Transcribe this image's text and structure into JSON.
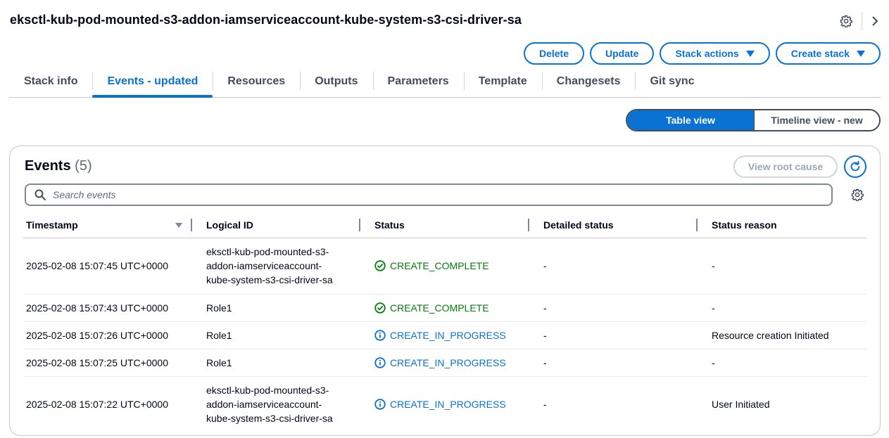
{
  "page": {
    "title": "eksctl-kub-pod-mounted-s3-addon-iamserviceaccount-kube-system-s3-csi-driver-sa"
  },
  "top_icons": [
    "gear-icon",
    "chevron-right-icon"
  ],
  "actions": {
    "delete": "Delete",
    "update": "Update",
    "stack_actions": "Stack actions",
    "create_stack": "Create stack"
  },
  "tabs": [
    {
      "label": "Stack info"
    },
    {
      "label": "Events - updated"
    },
    {
      "label": "Resources"
    },
    {
      "label": "Outputs"
    },
    {
      "label": "Parameters"
    },
    {
      "label": "Template"
    },
    {
      "label": "Changesets"
    },
    {
      "label": "Git sync"
    }
  ],
  "active_tab": "Events - updated",
  "view_toggle": {
    "table": "Table view",
    "timeline": "Timeline view - new",
    "selected": "Table view"
  },
  "events": {
    "title": "Events",
    "count": "(5)",
    "view_root_cause": "View root cause",
    "search_placeholder": "Search events",
    "columns": [
      "Timestamp",
      "Logical ID",
      "Status",
      "Detailed status",
      "Status reason"
    ],
    "rows": [
      {
        "timestamp": "2025-02-08 15:07:45 UTC+0000",
        "logical_id_lines": [
          "eksctl-kub-pod-mounted-s3-",
          "addon-iamserviceaccount-",
          "kube-system-s3-csi-driver-sa"
        ],
        "status": "CREATE_COMPLETE",
        "detailed_status": "-",
        "status_reason": "-"
      },
      {
        "timestamp": "2025-02-08 15:07:43 UTC+0000",
        "logical_id_lines": [
          "Role1"
        ],
        "status": "CREATE_COMPLETE",
        "detailed_status": "-",
        "status_reason": "-"
      },
      {
        "timestamp": "2025-02-08 15:07:26 UTC+0000",
        "logical_id_lines": [
          "Role1"
        ],
        "status": "CREATE_IN_PROGRESS",
        "detailed_status": "-",
        "status_reason": "Resource creation Initiated"
      },
      {
        "timestamp": "2025-02-08 15:07:25 UTC+0000",
        "logical_id_lines": [
          "Role1"
        ],
        "status": "CREATE_IN_PROGRESS",
        "detailed_status": "-",
        "status_reason": "-"
      },
      {
        "timestamp": "2025-02-08 15:07:22 UTC+0000",
        "logical_id_lines": [
          "eksctl-kub-pod-mounted-s3-",
          "addon-iamserviceaccount-",
          "kube-system-s3-csi-driver-sa"
        ],
        "status": "CREATE_IN_PROGRESS",
        "detailed_status": "-",
        "status_reason": "User Initiated"
      }
    ]
  },
  "colors": {
    "accent": "#0972d3",
    "success": "#037f0c",
    "text": "#000716"
  }
}
